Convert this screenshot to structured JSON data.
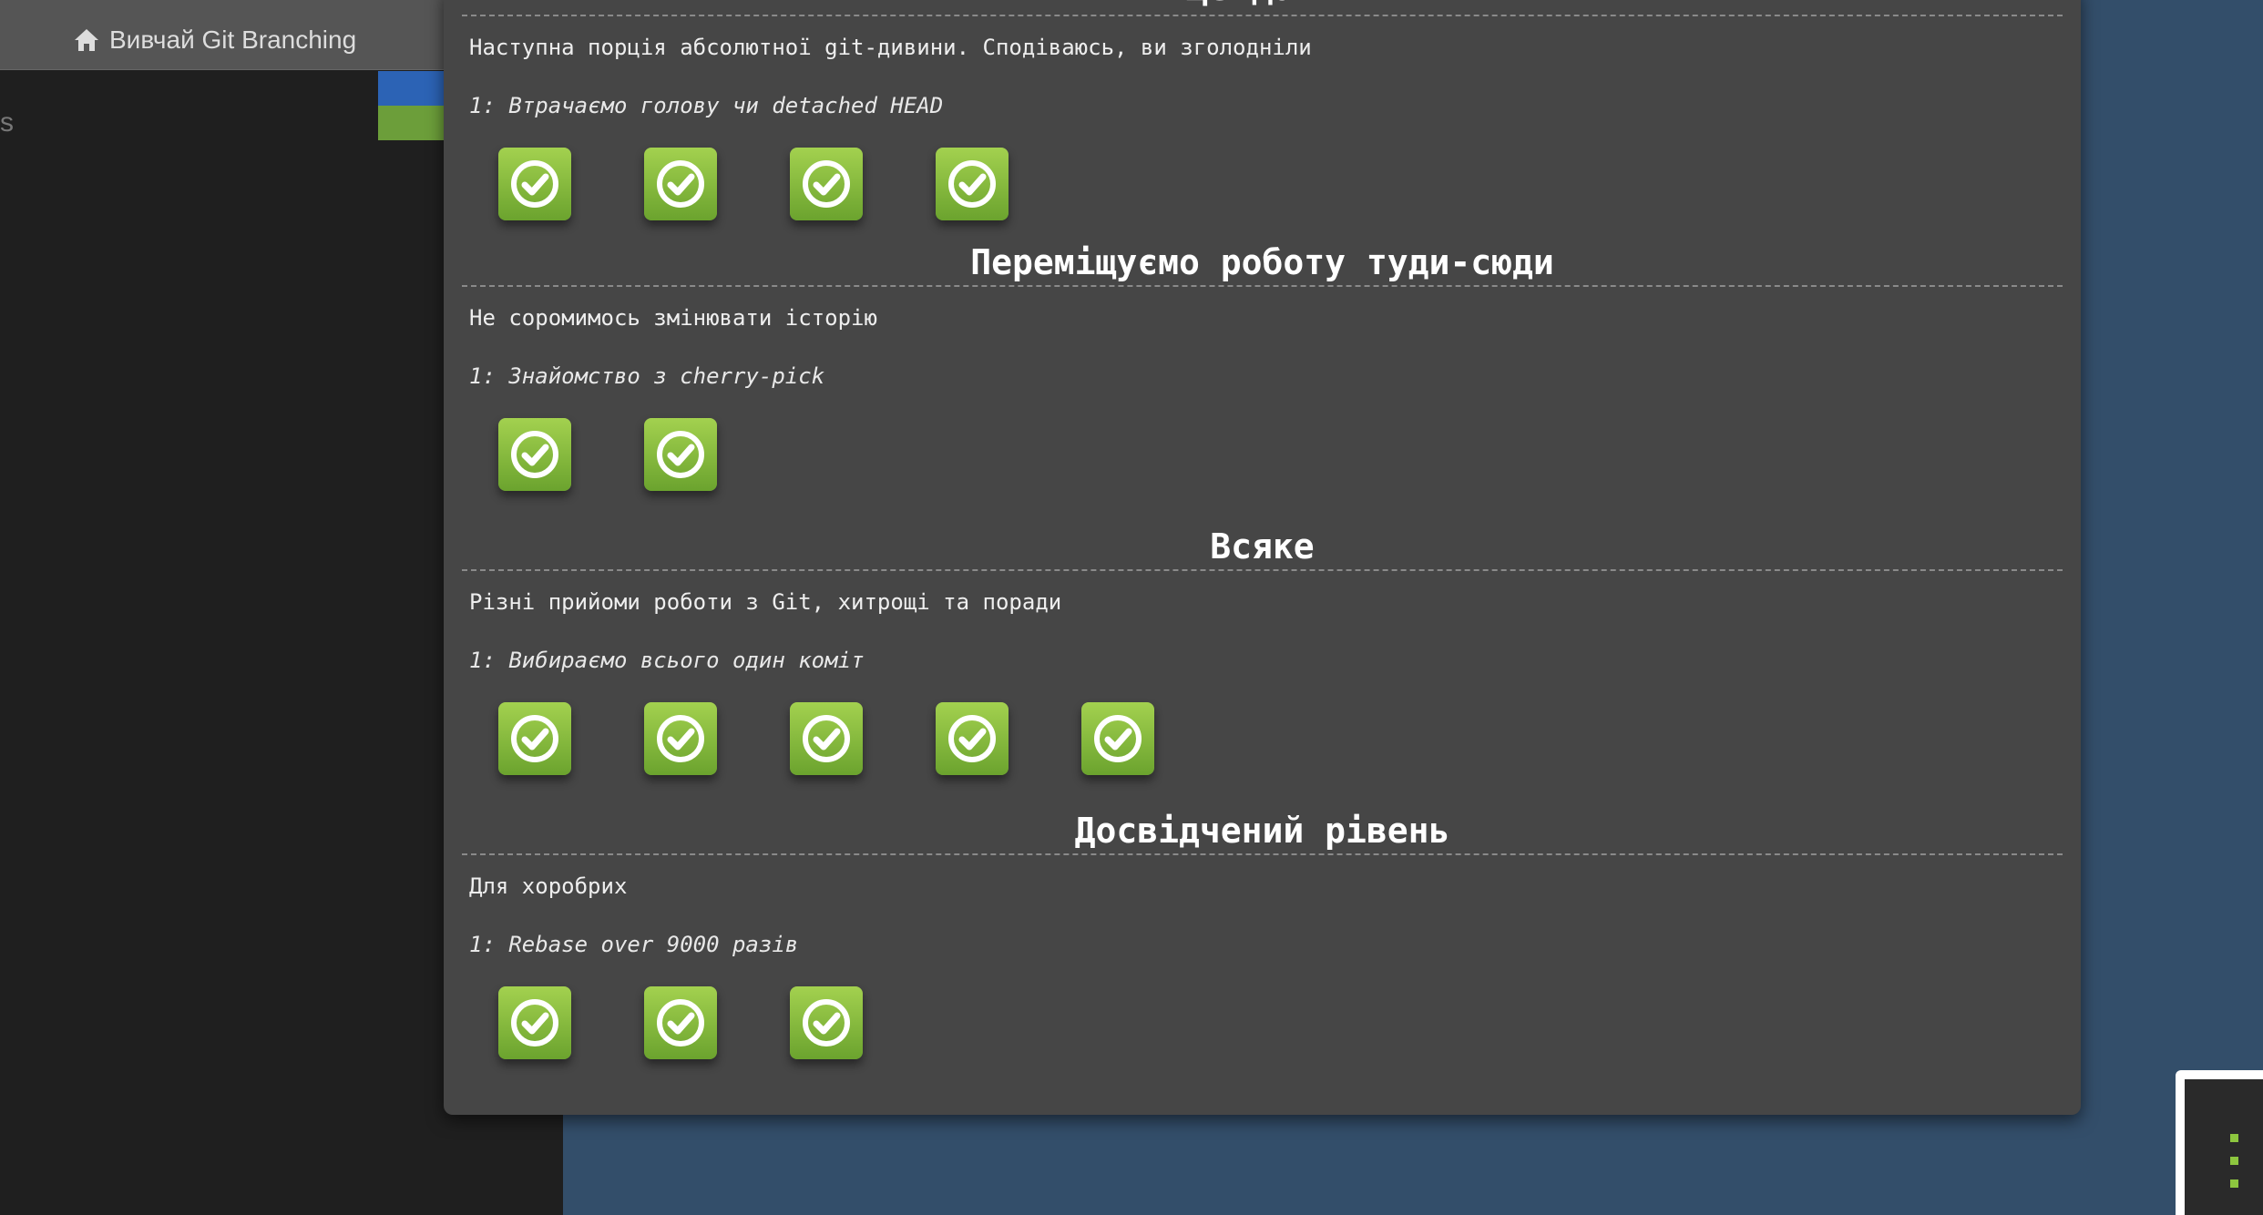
{
  "header": {
    "home_title": "Вивчай Git Branching",
    "home_icon": "home-icon"
  },
  "background": {
    "stray_text": "s"
  },
  "modal": {
    "cut_title": "Ще далі",
    "sections": [
      {
        "title": "",
        "about": "Наступна порція абсолютної git-дивини. Сподіваюсь, ви зголодніли",
        "level": "1: Втрачаємо голову чи detached HEAD",
        "levels": [
          true,
          true,
          true,
          true
        ]
      },
      {
        "title": "Переміщуємо роботу туди-сюди",
        "about": "Не соромимось змінювати історію",
        "level": "1: Знайомство з cherry-pick",
        "levels": [
          true,
          true
        ]
      },
      {
        "title": "Всяке",
        "about": "Різні прийоми роботи з Git, хитрощі та поради",
        "level": "1: Вибираємо всього один коміт",
        "levels": [
          true,
          true,
          true,
          true,
          true
        ]
      },
      {
        "title": "Досвідчений рівень",
        "about": "Для хоробрих",
        "level": "1: Rebase over 9000 разів",
        "levels": [
          true,
          true,
          true
        ]
      }
    ]
  },
  "colors": {
    "page_bg": "#334e6a",
    "modal_bg": "#464646",
    "level_complete": "#8dc63f",
    "flag_blue": "#2c63b5",
    "flag_green": "#6c9e3a"
  }
}
